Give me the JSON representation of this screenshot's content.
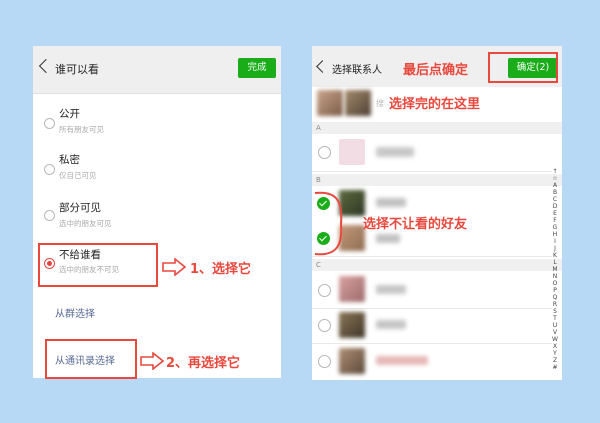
{
  "left": {
    "title": "谁可以看",
    "done_label": "完成",
    "options": [
      {
        "title": "公开",
        "subtitle": "所有朋友可见"
      },
      {
        "title": "私密",
        "subtitle": "仅自己可见"
      },
      {
        "title": "部分可见",
        "subtitle": "选中的朋友可见"
      },
      {
        "title": "不给谁看",
        "subtitle": "选中的朋友不可见"
      }
    ],
    "from_group": "从群选择",
    "from_contacts": "从通讯录选择"
  },
  "right": {
    "title": "选择联系人",
    "confirm_label": "确定(2)",
    "search_placeholder": "搜",
    "sections": [
      "A",
      "B",
      "C"
    ],
    "index_letters": [
      "↑",
      "☆",
      "A",
      "B",
      "C",
      "D",
      "E",
      "F",
      "G",
      "H",
      "I",
      "J",
      "K",
      "L",
      "M",
      "N",
      "O",
      "P",
      "Q",
      "R",
      "S",
      "T",
      "U",
      "V",
      "W",
      "X",
      "Y",
      "Z",
      "#"
    ]
  },
  "annotations": {
    "step1": "1、选择它",
    "step2": "2、再选择它",
    "confirm_last": "最后点确定",
    "selected_here": "选择完的在这里",
    "hide_friends": "选择不让看的好友"
  },
  "colors": {
    "background": "#b7d9f6",
    "accent_green": "#1aad19",
    "annotation_red": "#e9483d",
    "link_blue": "#576b95"
  }
}
